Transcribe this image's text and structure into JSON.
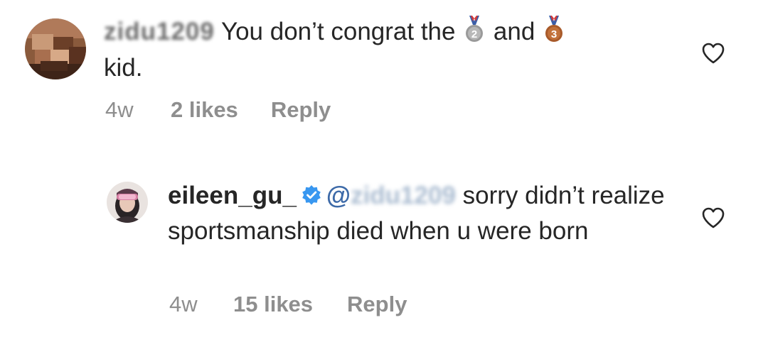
{
  "comments": [
    {
      "username": "zidu1209",
      "text_before": " You don’t congrat the ",
      "text_middle": " and ",
      "text_end": "kid.",
      "medals": [
        "second-place-medal",
        "third-place-medal"
      ],
      "time": "4w",
      "likes": "2 likes",
      "reply": "Reply",
      "heart_icon": "heart-outline-icon"
    },
    {
      "username": "eileen_gu_",
      "verified_icon": "verified-badge-icon",
      "mention": "zidu1209",
      "text": " sorry didn’t realize sportsmanship died when u were born",
      "time": "4w",
      "likes": "15 likes",
      "reply": "Reply",
      "heart_icon": "heart-outline-icon"
    }
  ],
  "colors": {
    "text": "#262626",
    "meta": "#8e8e8e",
    "verified": "#3897f0",
    "mention": "#3d6aa8"
  }
}
